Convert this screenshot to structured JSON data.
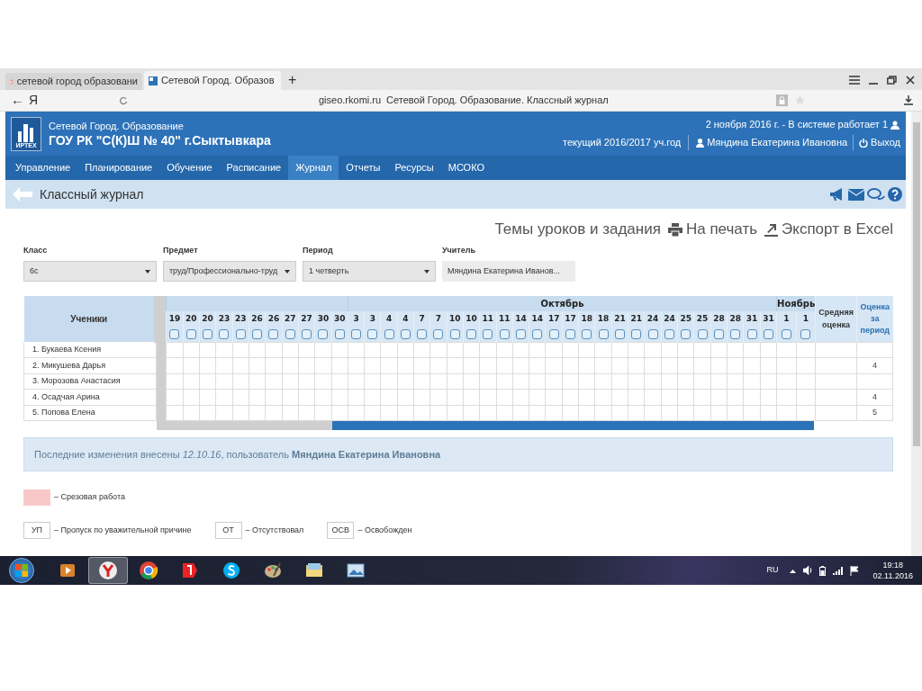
{
  "browser": {
    "tabs": [
      {
        "label": "сетевой город образовани",
        "selected": false
      },
      {
        "label": "Сетевой Город. Образов",
        "selected": true
      }
    ],
    "new_tab": "+",
    "back": "←",
    "logo": "Я",
    "domain": "giseo.rkomi.ru",
    "page_title": "Сетевой Город. Образование. Классный журнал"
  },
  "header": {
    "logo_text": "ИРТЕХ",
    "subtitle": "Сетевой Город. Образование",
    "school": "ГОУ РК \"С(К)Ш № 40\" г.Сыктывкара",
    "status": "2 ноября 2016 г. - В системе работает 1",
    "year": "текущий 2016/2017 уч.год",
    "user": "Мяндина Екатерина Ивановна",
    "logout": "Выход"
  },
  "nav": [
    {
      "label": "Управление",
      "selected": false
    },
    {
      "label": "Планирование",
      "selected": false
    },
    {
      "label": "Обучение",
      "selected": false
    },
    {
      "label": "Расписание",
      "selected": false
    },
    {
      "label": "Журнал",
      "selected": true
    },
    {
      "label": "Отчеты",
      "selected": false
    },
    {
      "label": "Ресурсы",
      "selected": false
    },
    {
      "label": "МСОКО",
      "selected": false
    }
  ],
  "page": {
    "title": "Классный журнал"
  },
  "actions": [
    {
      "kind": "text",
      "label": "Темы уроков и задания"
    },
    {
      "kind": "print",
      "label": "На печать"
    },
    {
      "kind": "export",
      "label": "Экспорт в Excel"
    }
  ],
  "filters": [
    {
      "kind": "select",
      "label": "Класс",
      "value": "6с"
    },
    {
      "kind": "select",
      "label": "Предмет",
      "value": "труд/Профессионально-труд"
    },
    {
      "kind": "select",
      "label": "Период",
      "value": "1 четверть"
    },
    {
      "kind": "readonly",
      "label": "Учитель",
      "value": "Мяндина Екатерина Иванов..."
    }
  ],
  "journal": {
    "students_header": "Ученики",
    "average_header": "Средняя оценка",
    "period_header": "Оценка за период",
    "months": [
      {
        "days": [
          {
            "day": "19",
            "checked": false
          },
          {
            "day": "20",
            "checked": false
          },
          {
            "day": "20",
            "checked": false
          },
          {
            "day": "23",
            "checked": false
          },
          {
            "day": "23",
            "checked": false
          },
          {
            "day": "26",
            "checked": false
          },
          {
            "day": "26",
            "checked": false
          },
          {
            "day": "27",
            "checked": false
          },
          {
            "day": "27",
            "checked": false
          },
          {
            "day": "30",
            "checked": false
          },
          {
            "day": "30",
            "checked": false
          }
        ]
      },
      {
        "name": "Октябрь",
        "days": [
          {
            "day": "3",
            "checked": false
          },
          {
            "day": "3",
            "checked": false
          },
          {
            "day": "4",
            "checked": false
          },
          {
            "day": "4",
            "checked": false
          },
          {
            "day": "7",
            "checked": false
          },
          {
            "day": "7",
            "checked": false
          },
          {
            "day": "10",
            "checked": false
          },
          {
            "day": "10",
            "checked": false
          },
          {
            "day": "11",
            "checked": false
          },
          {
            "day": "11",
            "checked": false
          },
          {
            "day": "14",
            "checked": false
          },
          {
            "day": "14",
            "checked": false
          },
          {
            "day": "17",
            "checked": false
          },
          {
            "day": "17",
            "checked": false
          },
          {
            "day": "18",
            "checked": false
          },
          {
            "day": "18",
            "checked": false
          },
          {
            "day": "21",
            "checked": false
          },
          {
            "day": "21",
            "checked": false
          },
          {
            "day": "24",
            "checked": false
          },
          {
            "day": "24",
            "checked": false
          },
          {
            "day": "25",
            "checked": false
          },
          {
            "day": "25",
            "checked": false
          },
          {
            "day": "28",
            "checked": false
          },
          {
            "day": "28",
            "checked": false
          },
          {
            "day": "31",
            "checked": false
          },
          {
            "day": "31",
            "checked": false
          }
        ]
      },
      {
        "name": "Ноябрь",
        "days": [
          {
            "day": "1",
            "checked": false
          },
          {
            "day": "1",
            "checked": false
          }
        ]
      }
    ],
    "students": [
      {
        "name": "1. Букаева Ксения"
      },
      {
        "name": "2. Микушева Дарья",
        "period": "4"
      },
      {
        "name": "3. Морозова Анастасия"
      },
      {
        "name": "4. Осадчая Арина",
        "period": "4"
      },
      {
        "name": "5. Попова Елена",
        "period": "5"
      }
    ]
  },
  "info": "Последние изменения внесены *12.10.16*, пользователь **Мяндина Екатерина Ивановна**",
  "legend": [
    {
      "kind": "swatch",
      "color": "#f8c8c8",
      "label": "– Срезовая работа"
    }
  ],
  "legend_codes": [
    {
      "code": "УП",
      "label": "– Пропуск по уважительной причине"
    },
    {
      "code": "ОТ",
      "label": "– Отсутствовал"
    },
    {
      "code": "ОСВ",
      "label": "– Освобожден"
    }
  ],
  "tray": {
    "lang": "RU",
    "time": "19:18",
    "date": "02.11.2016"
  }
}
